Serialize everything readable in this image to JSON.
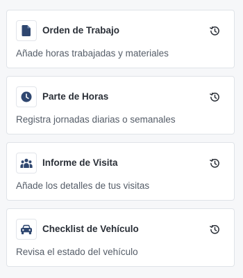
{
  "colors": {
    "icon": "#2f4770",
    "title": "#2a2f37",
    "description": "#555d68",
    "card_border": "#dfe3e8",
    "page_background": "#f6f7f9"
  },
  "cards": [
    {
      "icon": "document-icon",
      "title": "Orden de Trabajo",
      "description": "Añade horas trabajadas y materiales",
      "action_icon": "history-icon"
    },
    {
      "icon": "clock-icon",
      "title": "Parte de Horas",
      "description": "Registra jornadas diarias o semanales",
      "action_icon": "history-icon"
    },
    {
      "icon": "people-icon",
      "title": "Informe de Visita",
      "description": "Añade los detalles de tus visitas",
      "action_icon": "history-icon"
    },
    {
      "icon": "car-icon",
      "title": "Checklist de Vehículo",
      "description": "Revisa el estado del vehículo",
      "action_icon": "history-icon"
    }
  ]
}
